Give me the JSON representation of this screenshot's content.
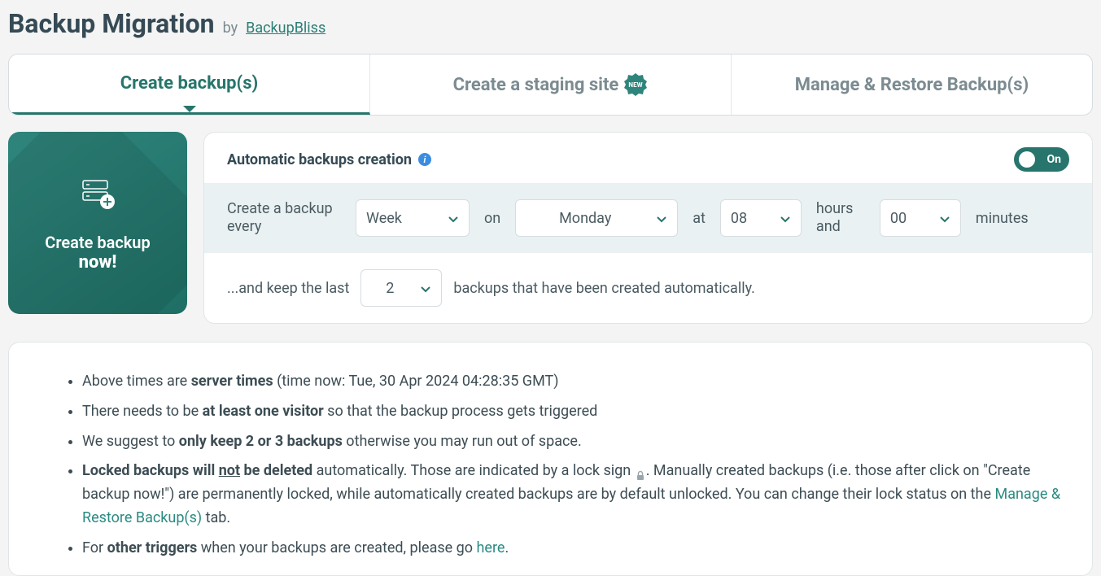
{
  "header": {
    "title": "Backup Migration",
    "by": "by",
    "brand": "BackupBliss"
  },
  "tabs": {
    "create": "Create backup(s)",
    "staging": "Create a staging site",
    "staging_badge": "NEW",
    "manage": "Manage & Restore Backup(s)"
  },
  "create_card": {
    "line1": "Create backup",
    "line2": "now!"
  },
  "settings": {
    "title": "Automatic backups creation",
    "toggle": "On",
    "lead": "Create a backup every",
    "interval": "Week",
    "on": "on",
    "day": "Monday",
    "at": "at",
    "hour": "08",
    "hours_and": "hours and",
    "minute": "00",
    "minutes": "minutes",
    "keep_pre": "...and keep the last",
    "keep_count": "2",
    "keep_post": "backups that have been created automatically."
  },
  "notes": {
    "li1_a": "Above times are ",
    "li1_b": "server times",
    "li1_c": " (time now: Tue, 30 Apr 2024 04:28:35 GMT)",
    "li2_a": "There needs to be ",
    "li2_b": "at least one visitor",
    "li2_c": " so that the backup process gets triggered",
    "li3_a": "We suggest to ",
    "li3_b": "only keep 2 or 3 backups",
    "li3_c": " otherwise you may run out of space.",
    "li4_a": "Locked backups will ",
    "li4_not": "not",
    "li4_b": " be deleted",
    "li4_c": " automatically. Those are indicated by a lock sign ",
    "li4_d": ". Manually created backups (i.e. those after click on \"Create backup now!\") are permanently locked, while automatically created backups are by default unlocked. You can change their lock status on the ",
    "li4_link": "Manage & Restore Backup(s)",
    "li4_e": " tab.",
    "li5_a": "For ",
    "li5_b": "other triggers",
    "li5_c": " when your backups are created, please go ",
    "li5_link": "here",
    "li5_d": "."
  }
}
